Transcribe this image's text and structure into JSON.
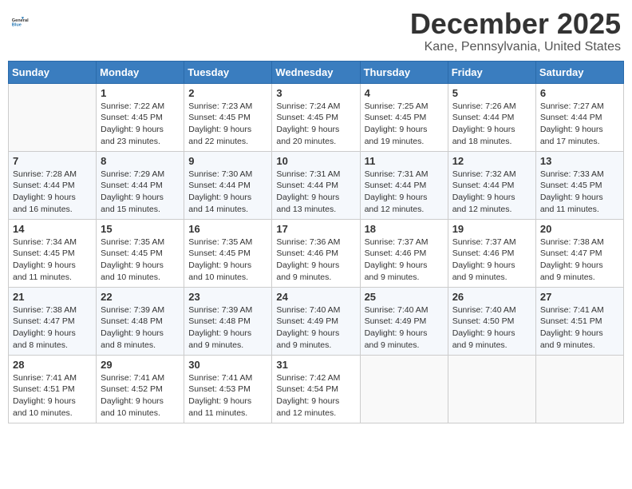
{
  "logo": {
    "general": "General",
    "blue": "Blue"
  },
  "title": "December 2025",
  "location": "Kane, Pennsylvania, United States",
  "days_of_week": [
    "Sunday",
    "Monday",
    "Tuesday",
    "Wednesday",
    "Thursday",
    "Friday",
    "Saturday"
  ],
  "weeks": [
    [
      {
        "day": "",
        "info": ""
      },
      {
        "day": "1",
        "info": "Sunrise: 7:22 AM\nSunset: 4:45 PM\nDaylight: 9 hours\nand 23 minutes."
      },
      {
        "day": "2",
        "info": "Sunrise: 7:23 AM\nSunset: 4:45 PM\nDaylight: 9 hours\nand 22 minutes."
      },
      {
        "day": "3",
        "info": "Sunrise: 7:24 AM\nSunset: 4:45 PM\nDaylight: 9 hours\nand 20 minutes."
      },
      {
        "day": "4",
        "info": "Sunrise: 7:25 AM\nSunset: 4:45 PM\nDaylight: 9 hours\nand 19 minutes."
      },
      {
        "day": "5",
        "info": "Sunrise: 7:26 AM\nSunset: 4:44 PM\nDaylight: 9 hours\nand 18 minutes."
      },
      {
        "day": "6",
        "info": "Sunrise: 7:27 AM\nSunset: 4:44 PM\nDaylight: 9 hours\nand 17 minutes."
      }
    ],
    [
      {
        "day": "7",
        "info": "Sunrise: 7:28 AM\nSunset: 4:44 PM\nDaylight: 9 hours\nand 16 minutes."
      },
      {
        "day": "8",
        "info": "Sunrise: 7:29 AM\nSunset: 4:44 PM\nDaylight: 9 hours\nand 15 minutes."
      },
      {
        "day": "9",
        "info": "Sunrise: 7:30 AM\nSunset: 4:44 PM\nDaylight: 9 hours\nand 14 minutes."
      },
      {
        "day": "10",
        "info": "Sunrise: 7:31 AM\nSunset: 4:44 PM\nDaylight: 9 hours\nand 13 minutes."
      },
      {
        "day": "11",
        "info": "Sunrise: 7:31 AM\nSunset: 4:44 PM\nDaylight: 9 hours\nand 12 minutes."
      },
      {
        "day": "12",
        "info": "Sunrise: 7:32 AM\nSunset: 4:44 PM\nDaylight: 9 hours\nand 12 minutes."
      },
      {
        "day": "13",
        "info": "Sunrise: 7:33 AM\nSunset: 4:45 PM\nDaylight: 9 hours\nand 11 minutes."
      }
    ],
    [
      {
        "day": "14",
        "info": "Sunrise: 7:34 AM\nSunset: 4:45 PM\nDaylight: 9 hours\nand 11 minutes."
      },
      {
        "day": "15",
        "info": "Sunrise: 7:35 AM\nSunset: 4:45 PM\nDaylight: 9 hours\nand 10 minutes."
      },
      {
        "day": "16",
        "info": "Sunrise: 7:35 AM\nSunset: 4:45 PM\nDaylight: 9 hours\nand 10 minutes."
      },
      {
        "day": "17",
        "info": "Sunrise: 7:36 AM\nSunset: 4:46 PM\nDaylight: 9 hours\nand 9 minutes."
      },
      {
        "day": "18",
        "info": "Sunrise: 7:37 AM\nSunset: 4:46 PM\nDaylight: 9 hours\nand 9 minutes."
      },
      {
        "day": "19",
        "info": "Sunrise: 7:37 AM\nSunset: 4:46 PM\nDaylight: 9 hours\nand 9 minutes."
      },
      {
        "day": "20",
        "info": "Sunrise: 7:38 AM\nSunset: 4:47 PM\nDaylight: 9 hours\nand 9 minutes."
      }
    ],
    [
      {
        "day": "21",
        "info": "Sunrise: 7:38 AM\nSunset: 4:47 PM\nDaylight: 9 hours\nand 8 minutes."
      },
      {
        "day": "22",
        "info": "Sunrise: 7:39 AM\nSunset: 4:48 PM\nDaylight: 9 hours\nand 8 minutes."
      },
      {
        "day": "23",
        "info": "Sunrise: 7:39 AM\nSunset: 4:48 PM\nDaylight: 9 hours\nand 9 minutes."
      },
      {
        "day": "24",
        "info": "Sunrise: 7:40 AM\nSunset: 4:49 PM\nDaylight: 9 hours\nand 9 minutes."
      },
      {
        "day": "25",
        "info": "Sunrise: 7:40 AM\nSunset: 4:49 PM\nDaylight: 9 hours\nand 9 minutes."
      },
      {
        "day": "26",
        "info": "Sunrise: 7:40 AM\nSunset: 4:50 PM\nDaylight: 9 hours\nand 9 minutes."
      },
      {
        "day": "27",
        "info": "Sunrise: 7:41 AM\nSunset: 4:51 PM\nDaylight: 9 hours\nand 9 minutes."
      }
    ],
    [
      {
        "day": "28",
        "info": "Sunrise: 7:41 AM\nSunset: 4:51 PM\nDaylight: 9 hours\nand 10 minutes."
      },
      {
        "day": "29",
        "info": "Sunrise: 7:41 AM\nSunset: 4:52 PM\nDaylight: 9 hours\nand 10 minutes."
      },
      {
        "day": "30",
        "info": "Sunrise: 7:41 AM\nSunset: 4:53 PM\nDaylight: 9 hours\nand 11 minutes."
      },
      {
        "day": "31",
        "info": "Sunrise: 7:42 AM\nSunset: 4:54 PM\nDaylight: 9 hours\nand 12 minutes."
      },
      {
        "day": "",
        "info": ""
      },
      {
        "day": "",
        "info": ""
      },
      {
        "day": "",
        "info": ""
      }
    ]
  ]
}
